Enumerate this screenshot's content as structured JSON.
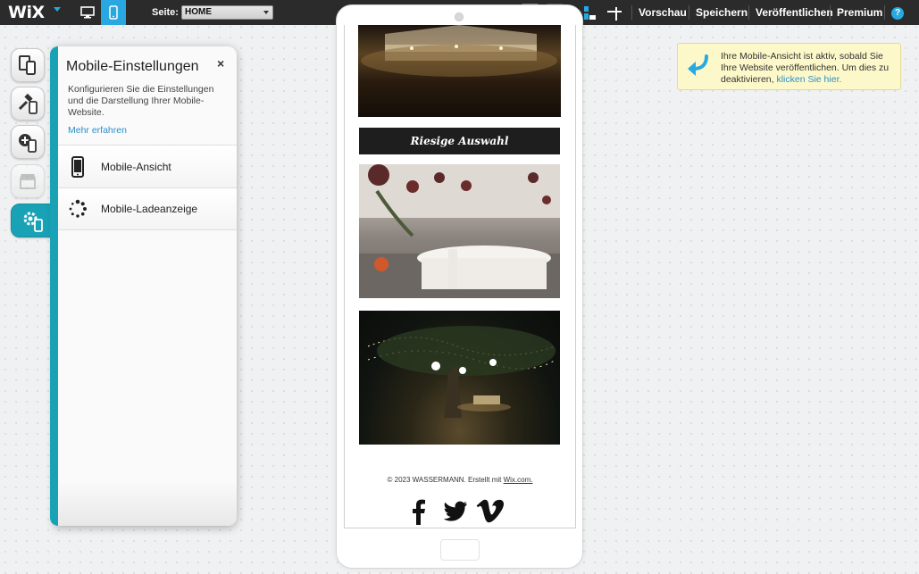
{
  "topbar": {
    "logo": "WiX",
    "page_label": "Seite:",
    "page_select_value": "HOME",
    "links": [
      "Vorschau",
      "Speichern",
      "Veröffentlichen",
      "Premium"
    ],
    "help": "?",
    "colors": {
      "bar": "#2b2b2b",
      "accent": "#28a7e1"
    }
  },
  "rail": {
    "icons": [
      "mobile-pages-icon",
      "hammer-mobile-icon",
      "add-mobile-icon",
      "store-icon",
      "gear-mobile-icon"
    ]
  },
  "panel": {
    "title": "Mobile-Einstellungen",
    "close": "×",
    "description": "Konfigurieren Sie die Einstellungen und die Darstellung Ihrer Mobile-Website.",
    "more_link": "Mehr erfahren",
    "items": [
      {
        "label": "Mobile-Ansicht",
        "icon": "phone-icon"
      },
      {
        "label": "Mobile-Ladeanzeige",
        "icon": "loading-spinner-icon"
      }
    ],
    "accent": "#19a2b6"
  },
  "phone": {
    "banner": "Riesige Auswahl",
    "footer_text": "© 2023 WASSERMANN. Erstellt mit ",
    "footer_link": "Wix.com.",
    "social": [
      "facebook-icon",
      "twitter-icon",
      "vimeo-icon"
    ]
  },
  "notification": {
    "text": "Ihre Mobile-Ansicht ist aktiv, sobald Sie Ihre Website veröffentlichen. Um dies zu deaktivieren, ",
    "link": "klicken Sie hier.",
    "colors": {
      "background": "#fdf8c9",
      "arrow": "#27a9e1"
    }
  }
}
